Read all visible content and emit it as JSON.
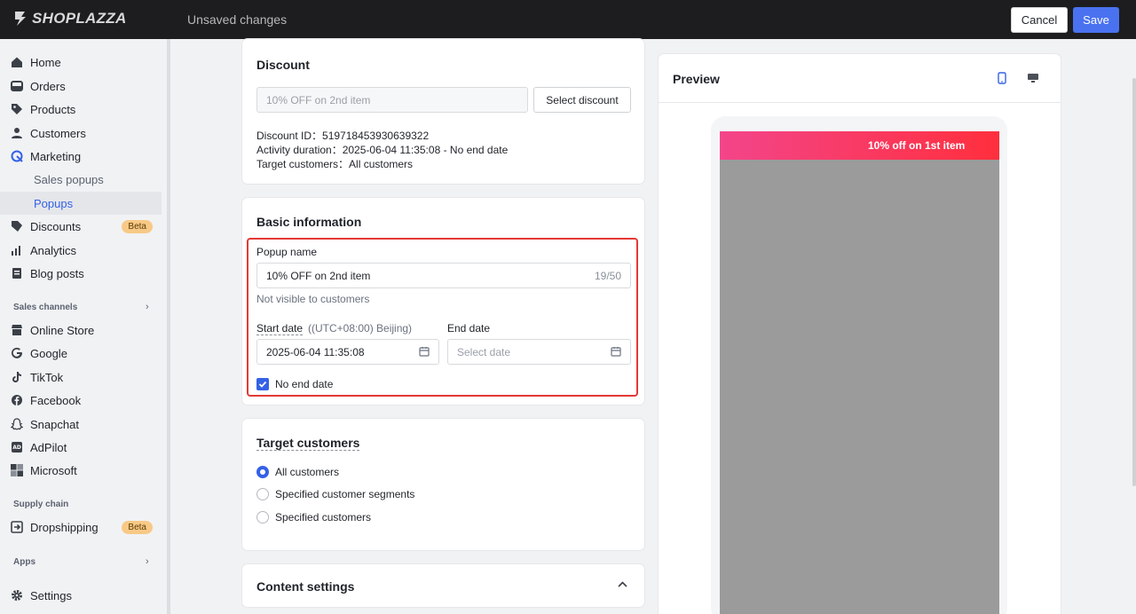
{
  "topbar": {
    "brand": "SHOPLAZZA",
    "status": "Unsaved changes",
    "cancel_label": "Cancel",
    "save_label": "Save"
  },
  "sidebar": {
    "items": [
      {
        "label": "Home",
        "icon": "home-icon"
      },
      {
        "label": "Orders",
        "icon": "orders-icon"
      },
      {
        "label": "Products",
        "icon": "tag-icon"
      },
      {
        "label": "Customers",
        "icon": "person-icon"
      },
      {
        "label": "Marketing",
        "icon": "marketing-icon"
      },
      {
        "label": "Sales popups"
      },
      {
        "label": "Popups"
      },
      {
        "label": "Discounts",
        "icon": "discount-icon",
        "badge": "Beta"
      },
      {
        "label": "Analytics",
        "icon": "analytics-icon"
      },
      {
        "label": "Blog posts",
        "icon": "blog-icon"
      }
    ],
    "sales_channels_heading": "Sales channels",
    "channels": [
      {
        "label": "Online Store",
        "icon": "store-icon"
      },
      {
        "label": "Google",
        "icon": "google-icon"
      },
      {
        "label": "TikTok",
        "icon": "tiktok-icon"
      },
      {
        "label": "Facebook",
        "icon": "facebook-icon"
      },
      {
        "label": "Snapchat",
        "icon": "snapchat-icon"
      },
      {
        "label": "AdPilot",
        "icon": "adpilot-icon"
      },
      {
        "label": "Microsoft",
        "icon": "microsoft-icon"
      }
    ],
    "supply_chain_heading": "Supply chain",
    "dropshipping": {
      "label": "Dropshipping",
      "badge": "Beta"
    },
    "apps_heading": "Apps",
    "settings_label": "Settings"
  },
  "discount": {
    "title": "Discount",
    "selected_value": "10% OFF on 2nd item",
    "select_button": "Select discount",
    "discount_id": "Discount ID：519718453930639322",
    "activity_duration": "Activity duration：2025-06-04 11:35:08 - No end date",
    "target_customers": "Target customers：All customers"
  },
  "basic_info": {
    "title": "Basic information",
    "popup_name_label": "Popup name",
    "popup_name_value": "10% OFF on 2nd item",
    "popup_name_counter": "19/50",
    "popup_name_help": "Not visible to customers",
    "start_date_label": "Start date",
    "timezone": "((UTC+08:00) Beijing)",
    "start_date_value": "2025-06-04 11:35:08",
    "end_date_label": "End date",
    "end_date_placeholder": "Select date",
    "no_end_date_label": "No end date",
    "no_end_date_checked": true
  },
  "target_customers": {
    "title": "Target customers",
    "options": [
      "All customers",
      "Specified customer segments",
      "Specified customers"
    ],
    "selected_index": 0
  },
  "content_settings": {
    "title": "Content settings"
  },
  "preview": {
    "title": "Preview",
    "banner_text": "10% off on 1st item",
    "mobile_icon": "mobile-icon",
    "desktop_icon": "desktop-icon"
  },
  "colors": {
    "accent": "#3561e6",
    "save": "#4a72f0",
    "highlight": "#e53935",
    "badge": "#f8c986"
  }
}
